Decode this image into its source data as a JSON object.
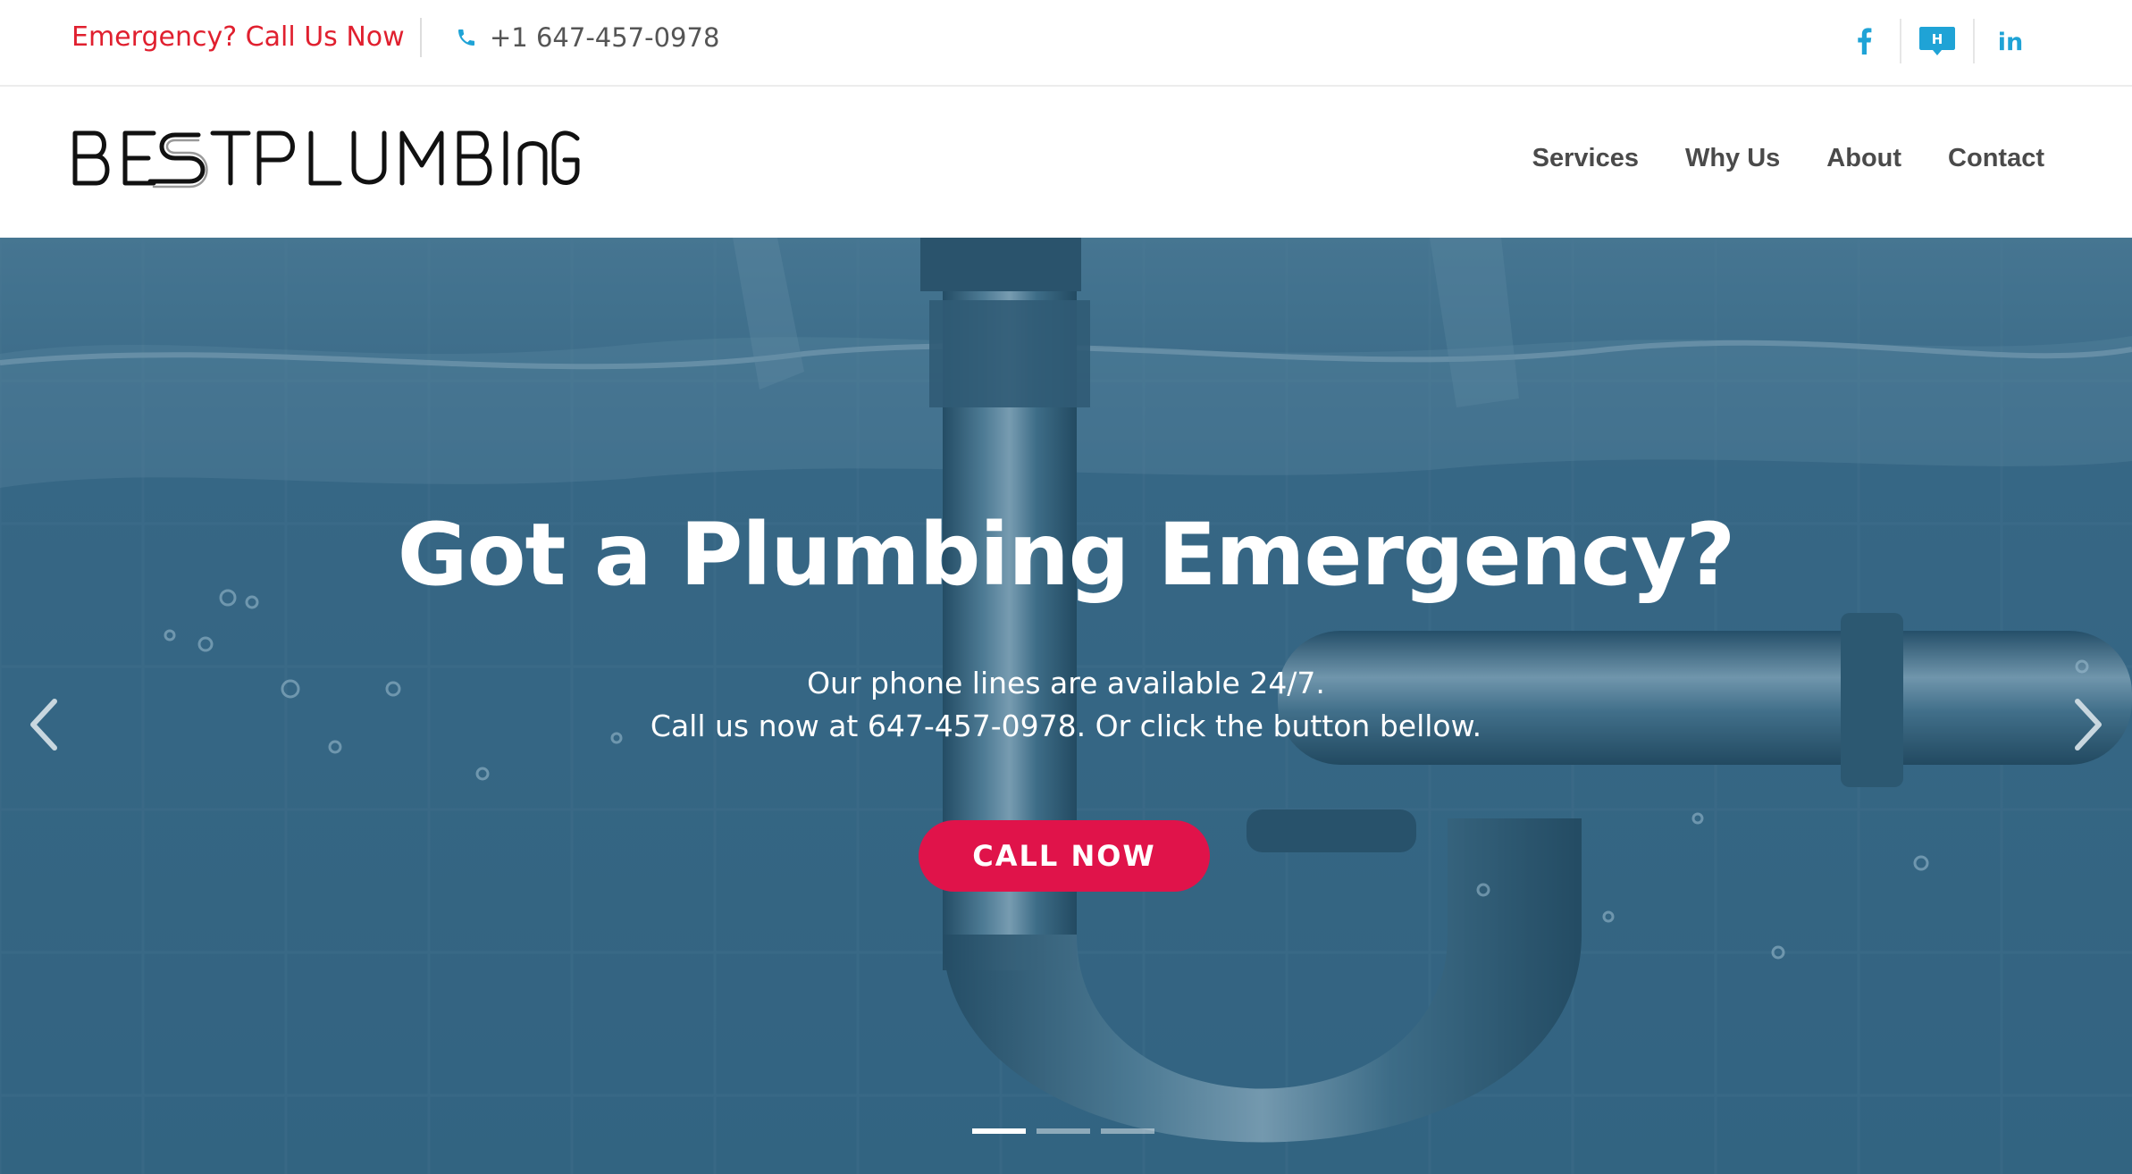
{
  "topbar": {
    "emergency_text": "Emergency? Call Us Now",
    "phone": "+1 647-457-0978",
    "phone_icon": "phone-icon",
    "social": [
      {
        "name": "facebook-icon"
      },
      {
        "name": "homestars-icon",
        "glyph": "H"
      },
      {
        "name": "linkedin-icon",
        "glyph": "in"
      }
    ],
    "accent_color": "#e0202f",
    "icon_color": "#1fa3d6"
  },
  "header": {
    "logo_text": "BEST PLUMBING",
    "nav": [
      {
        "label": "Services"
      },
      {
        "label": "Why Us"
      },
      {
        "label": "About"
      },
      {
        "label": "Contact"
      }
    ]
  },
  "hero": {
    "title": "Got a Plumbing Emergency?",
    "line1": "Our phone lines are available 24/7.",
    "line2": "Call us now at 647-457-0978. Or click the button bellow.",
    "cta_label": "CALL NOW",
    "cta_color": "#e0134a",
    "prev_icon": "chevron-left-icon",
    "next_icon": "chevron-right-icon",
    "slides_total": 3,
    "active_slide": 1
  }
}
